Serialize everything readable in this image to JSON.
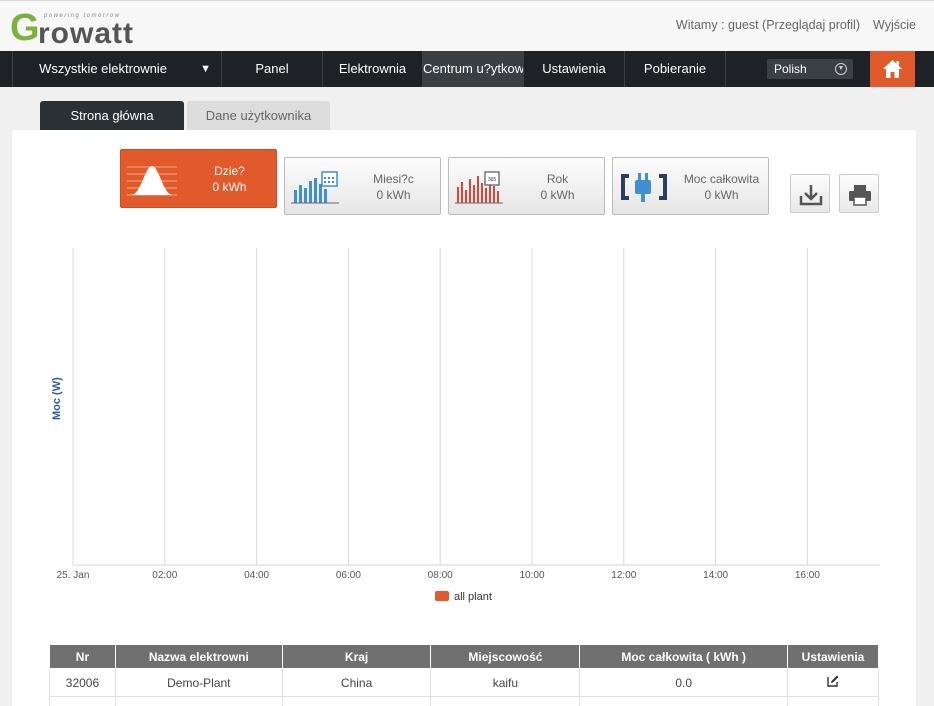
{
  "logo": {
    "letter": "G",
    "rest": "rowatt",
    "tagline": "powering tomorrow"
  },
  "header": {
    "welcome": "Witamy : guest (Przeglądaj profil)",
    "logout": "Wyjście"
  },
  "nav": {
    "items": [
      {
        "label": "Wszystkie elektrownie",
        "caret": "▼"
      },
      {
        "label": "Panel"
      },
      {
        "label": "Elektrownia"
      },
      {
        "label": "Centrum u?ytkow",
        "active": true
      },
      {
        "label": "Ustawienia"
      },
      {
        "label": "Pobieranie"
      }
    ],
    "language": "Polish",
    "home_icon": "home-icon"
  },
  "tabs": [
    {
      "label": "Strona główna",
      "active": true
    },
    {
      "label": "Dane użytkownika",
      "active": false
    }
  ],
  "stats": [
    {
      "label": "Dzie?",
      "value": "0 kWh",
      "icon": "bell-curve-icon",
      "active": true
    },
    {
      "label": "Miesi?c",
      "value": "0 kWh",
      "icon": "month-bar-calendar-icon",
      "active": false
    },
    {
      "label": "Rok",
      "value": "0 kWh",
      "icon": "year-bar-icon",
      "active": false
    },
    {
      "label": "Moc całkowita",
      "value": "0 kWh",
      "icon": "plug-icon",
      "active": false
    }
  ],
  "tools": {
    "download_icon": "download-icon",
    "print_icon": "print-icon"
  },
  "chart_data": {
    "type": "line",
    "ylabel": "Moc (W)",
    "x_ticks": [
      "25. Jan",
      "02:00",
      "04:00",
      "06:00",
      "08:00",
      "10:00",
      "12:00",
      "14:00",
      "16:00"
    ],
    "series": [
      {
        "name": "all plant",
        "color": "#e05a2b",
        "values": []
      }
    ],
    "grid": true,
    "legend": "bottom-center"
  },
  "table": {
    "headers": [
      "Nr",
      "Nazwa elektrowni",
      "Kraj",
      "Miejscowość",
      "Moc całkowita ( kWh )",
      "Ustawienia"
    ],
    "rows": [
      {
        "nr": "32006",
        "name": "Demo-Plant",
        "country": "China",
        "city": "kaifu",
        "total": "0.0",
        "settings_icon": "edit-icon"
      }
    ]
  },
  "colors": {
    "accent": "#e05a2b",
    "nav_bg": "#1e2226",
    "header_th": "#707070",
    "axis_label": "#2d5b8f"
  }
}
